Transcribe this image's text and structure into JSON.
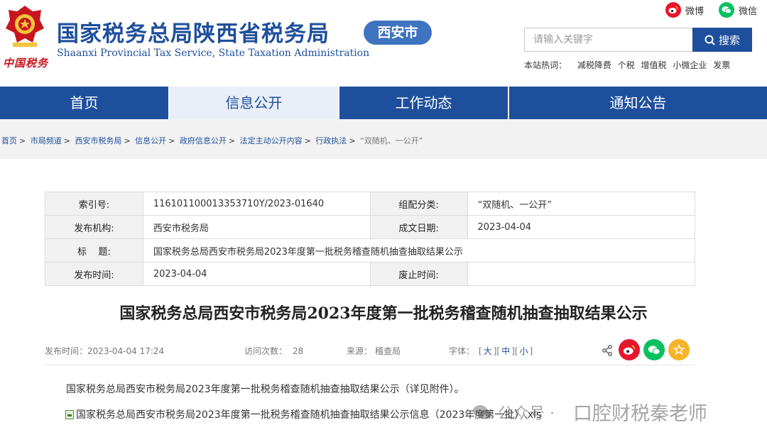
{
  "header": {
    "logo_cursive": "中国税务",
    "site_title": "国家税务总局陕西省税务局",
    "site_subtitle": "Shaanxi Provincial Tax Service, State Taxation Administration",
    "city_badge": "西安市",
    "social": [
      {
        "name": "weibo",
        "label": "微博",
        "color": "#e6162d"
      },
      {
        "name": "wechat",
        "label": "微信",
        "color": "#07c160"
      }
    ],
    "search": {
      "placeholder": "请输入关键字",
      "button_label": "搜索"
    },
    "hotwords": {
      "label": "本站热词：",
      "items": [
        "减税降费",
        "个税",
        "增值税",
        "小微企业",
        "发票"
      ]
    }
  },
  "nav": {
    "items": [
      "首页",
      "信息公开",
      "工作动态",
      "通知公告"
    ],
    "active_index": 1
  },
  "breadcrumb": [
    "首页",
    "市局频道",
    "西安市税务局",
    "信息公开",
    "政府信息公开",
    "法定主动公开内容",
    "行政执法",
    "“双随机、一公开”"
  ],
  "meta": {
    "rows": [
      [
        {
          "k": "索引号:",
          "v": "116101100013353710Y/2023-01640"
        },
        {
          "k": "组配分类:",
          "v": "“双随机、一公开”"
        }
      ],
      [
        {
          "k": "发布机构:",
          "v": "西安市税务局"
        },
        {
          "k": "成文日期:",
          "v": "2023-04-04"
        }
      ],
      [
        {
          "k": "标    题:",
          "v": "国家税务总局西安市税务局2023年度第一批税务稽查随机抽查抽取结果公示"
        }
      ],
      [
        {
          "k": "发布时间:",
          "v": "2023-04-04"
        },
        {
          "k": "废止时间:",
          "v": ""
        }
      ]
    ]
  },
  "article": {
    "title": "国家税务总局西安市税务局2023年度第一批税务稽查随机抽查抽取结果公示",
    "info": {
      "publish_label": "发布时间：",
      "publish_value": "2023-04-04 17:24",
      "visits_label": "访问次数：",
      "visits_value": "28",
      "source_label": "来源：",
      "source_value": "稽查局",
      "font_label": "字体：",
      "font_sizes": [
        "大",
        "中",
        "小"
      ]
    },
    "body": "国家税务总局西安市税务局2023年度第一批税务稽查随机抽查抽取结果公示（详见附件）。",
    "attachment": "国家税务总局西安市税务局2023年度第一批税务稽查随机抽查抽取结果公示信息（2023年度第一批）.xls"
  },
  "watermark": {
    "prefix": "公众号 ·",
    "name": "口腔财税秦老师"
  },
  "colors": {
    "brand_blue": "#1e4f9c",
    "badge_blue": "#3e73bf",
    "weibo_red": "#e6162d",
    "wechat_green": "#07c160",
    "star_yellow": "#f5b427",
    "emblem_red": "#c8161d"
  }
}
